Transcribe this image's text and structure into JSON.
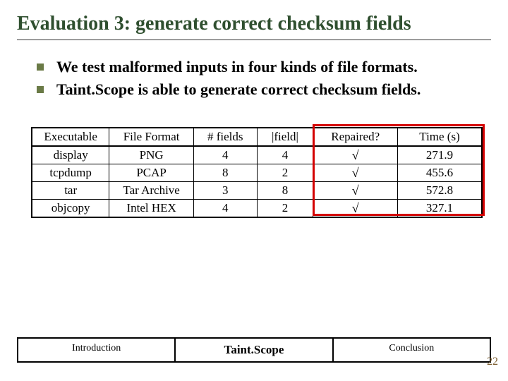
{
  "title": "Evaluation 3: generate correct checksum fields",
  "bullets": [
    "We test malformed inputs in four kinds of file formats.",
    "Taint.Scope is able to generate correct checksum fields."
  ],
  "chart_data": {
    "type": "table",
    "headers": [
      "Executable",
      "File Format",
      "# fields",
      "|field|",
      "Repaired?",
      "Time (s)"
    ],
    "rows": [
      {
        "exe": "display",
        "fmt": "PNG",
        "nf": "4",
        "flen": "4",
        "rep": "√",
        "time": "271.9"
      },
      {
        "exe": "tcpdump",
        "fmt": "PCAP",
        "nf": "8",
        "flen": "2",
        "rep": "√",
        "time": "455.6"
      },
      {
        "exe": "tar",
        "fmt": "Tar Archive",
        "nf": "3",
        "flen": "8",
        "rep": "√",
        "time": "572.8"
      },
      {
        "exe": "objcopy",
        "fmt": "Intel HEX",
        "nf": "4",
        "flen": "2",
        "rep": "√",
        "time": "327.1"
      }
    ]
  },
  "footer": {
    "intro": "Introduction",
    "mid": "Taint.Scope",
    "concl": "Conclusion"
  },
  "page": "22"
}
